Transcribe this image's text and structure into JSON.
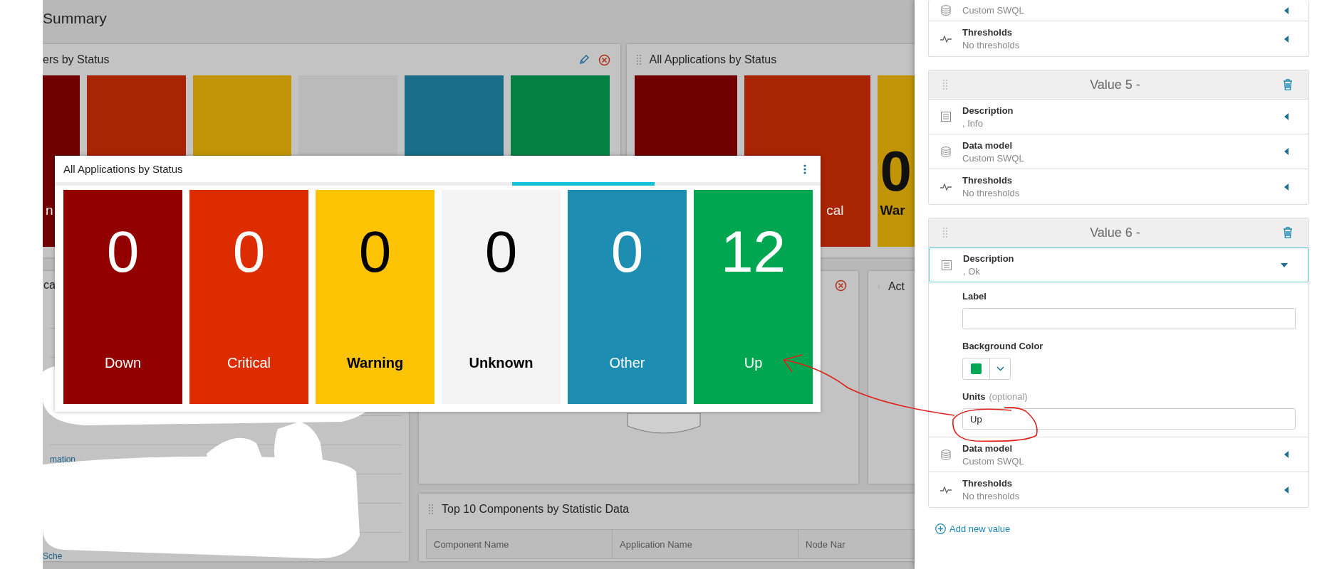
{
  "page_title": "Summary",
  "status_panel": {
    "title": "ers by Status",
    "tiles": [
      {
        "color": "#700000",
        "label": "n",
        "dark_label": false
      },
      {
        "color": "#a82403"
      },
      {
        "color": "#c19507"
      },
      {
        "color": "#bababa"
      },
      {
        "color": "#1a6e89"
      },
      {
        "color": "#048043"
      }
    ]
  },
  "apps_panel": {
    "title": "All Applications by Status",
    "tiles": [
      {
        "color": "#700000"
      },
      {
        "color": "#a82403",
        "label": "cal",
        "dark_label": false
      },
      {
        "color": "#c19507",
        "value": "0",
        "label": "War",
        "dark_label": true
      }
    ]
  },
  "left_panel": {
    "title": "ca",
    "links": [
      "mation",
      "Sche"
    ]
  },
  "activity_panel": {
    "title": "Act"
  },
  "components_panel": {
    "title": "Top 10 Components by Statistic Data",
    "columns": [
      "Component Name",
      "Application Name",
      "Node Nar"
    ]
  },
  "overlay": {
    "title": "All Applications by Status",
    "tiles": [
      {
        "value": "0",
        "label": "Down",
        "color": "#930000",
        "dark_label": false
      },
      {
        "value": "0",
        "label": "Critical",
        "color": "#dd2c00",
        "dark_label": false
      },
      {
        "value": "0",
        "label": "Warning",
        "color": "#fdc406",
        "dark_label": true
      },
      {
        "value": "0",
        "label": "Unknown",
        "color": "#f3f3f3",
        "dark_label": true
      },
      {
        "value": "0",
        "label": "Other",
        "color": "#1e8db2",
        "dark_label": false
      },
      {
        "value": "12",
        "label": "Up",
        "color": "#00a650",
        "dark_label": false
      }
    ]
  },
  "settings": {
    "cards": [
      {
        "rows": [
          {
            "kind": "database",
            "sub": "Custom SWQL",
            "expanded": false
          },
          {
            "kind": "thresholds",
            "label": "Thresholds",
            "sub": "No thresholds",
            "expanded": false
          }
        ]
      },
      {
        "title": "Value 5 -",
        "rows": [
          {
            "kind": "description",
            "label": "Description",
            "sub": ", Info",
            "expanded": false
          },
          {
            "kind": "database",
            "label": "Data model",
            "sub": "Custom SWQL",
            "expanded": false
          },
          {
            "kind": "thresholds",
            "label": "Thresholds",
            "sub": "No thresholds",
            "expanded": false
          }
        ]
      },
      {
        "title": "Value 6 -",
        "rows": [
          {
            "kind": "description",
            "label": "Description",
            "sub": ", Ok",
            "expanded": true,
            "fields": [
              {
                "kind": "text",
                "label": "Label"
              },
              {
                "kind": "color",
                "label": "Background Color",
                "color": "#00a650"
              },
              {
                "kind": "text",
                "label": "Units",
                "note": "(optional)",
                "value": "Up"
              }
            ]
          },
          {
            "kind": "database",
            "label": "Data model",
            "sub": "Custom SWQL",
            "expanded": false
          },
          {
            "kind": "thresholds",
            "label": "Thresholds",
            "sub": "No thresholds",
            "expanded": false
          }
        ]
      }
    ],
    "add_label": "Add new value"
  }
}
